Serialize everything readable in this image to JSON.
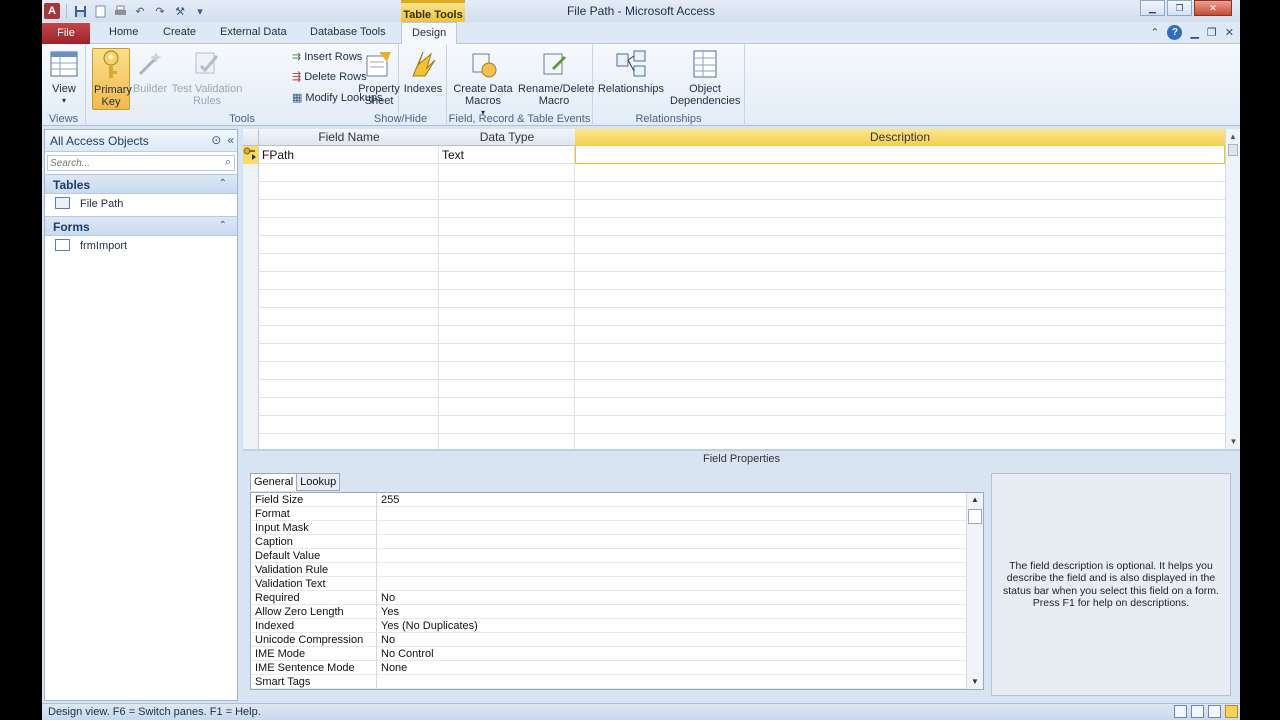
{
  "window": {
    "title": "File Path  -  Microsoft Access",
    "context_tab": "Table Tools"
  },
  "tabs": [
    "File",
    "Home",
    "Create",
    "External Data",
    "Database Tools",
    "Design"
  ],
  "ribbon": {
    "views": {
      "label": "Views",
      "view": "View"
    },
    "tools": {
      "label": "Tools",
      "primary_key": "Primary Key",
      "builder": "Builder",
      "test_validation": "Test Validation Rules",
      "insert_rows": "Insert Rows",
      "delete_rows": "Delete Rows",
      "modify_lookups": "Modify Lookups"
    },
    "show_hide": {
      "label": "Show/Hide",
      "property_sheet": "Property Sheet",
      "indexes": "Indexes"
    },
    "events": {
      "label": "Field, Record & Table Events",
      "create_data_macros": "Create Data Macros",
      "rename_delete_macro": "Rename/Delete Macro"
    },
    "relationships": {
      "label": "Relationships",
      "relationships": "Relationships",
      "object_dependencies": "Object Dependencies"
    }
  },
  "nav": {
    "title": "All Access Objects",
    "search_placeholder": "Search...",
    "sections": [
      {
        "title": "Tables",
        "items": [
          "File Path"
        ]
      },
      {
        "title": "Forms",
        "items": [
          "frmImport"
        ]
      }
    ]
  },
  "grid": {
    "headers": {
      "field_name": "Field Name",
      "data_type": "Data Type",
      "description": "Description"
    },
    "rows": [
      {
        "field_name": "FPath",
        "data_type": "Text",
        "description": ""
      }
    ]
  },
  "field_properties": {
    "title": "Field Properties",
    "tabs": [
      "General",
      "Lookup"
    ],
    "rows": [
      {
        "key": "Field Size",
        "value": "255"
      },
      {
        "key": "Format",
        "value": ""
      },
      {
        "key": "Input Mask",
        "value": ""
      },
      {
        "key": "Caption",
        "value": ""
      },
      {
        "key": "Default Value",
        "value": ""
      },
      {
        "key": "Validation Rule",
        "value": ""
      },
      {
        "key": "Validation Text",
        "value": ""
      },
      {
        "key": "Required",
        "value": "No"
      },
      {
        "key": "Allow Zero Length",
        "value": "Yes"
      },
      {
        "key": "Indexed",
        "value": "Yes (No Duplicates)"
      },
      {
        "key": "Unicode Compression",
        "value": "No"
      },
      {
        "key": "IME Mode",
        "value": "No Control"
      },
      {
        "key": "IME Sentence Mode",
        "value": "None"
      },
      {
        "key": "Smart Tags",
        "value": ""
      }
    ],
    "help_text": "The field description is optional. It helps you describe the field and is also displayed in the status bar when you select this field on a form. Press F1 for help on descriptions."
  },
  "status": {
    "text": "Design view.  F6 = Switch panes.  F1 = Help."
  },
  "colors": {
    "file_tab": "#9a2328",
    "context_tab": "#ecc13f",
    "selected_header": "#f5cf4e"
  }
}
